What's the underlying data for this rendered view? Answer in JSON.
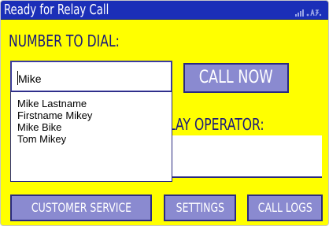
{
  "window": {
    "title": "Ready for Relay Call",
    "signal_icon": "signal-strength-icon"
  },
  "dial": {
    "label": "NUMBER TO DIAL:",
    "input_value": "Mike",
    "call_button": "CALL NOW"
  },
  "autocomplete": {
    "suggestions": [
      "Mike Lastname",
      "Firstname Mikey",
      "Mike Bike",
      "Tom Mikey"
    ]
  },
  "relay": {
    "label_visible": "LAY OPERATOR:"
  },
  "footer": {
    "customer_service": "CUSTOMER SERVICE",
    "settings": "SETTINGS",
    "call_logs": "CALL LOGS"
  },
  "colors": {
    "background": "#ffff00",
    "titlebar": "#1b2fb8",
    "button": "#8a8ad0",
    "label_text": "#1a1a7a"
  }
}
